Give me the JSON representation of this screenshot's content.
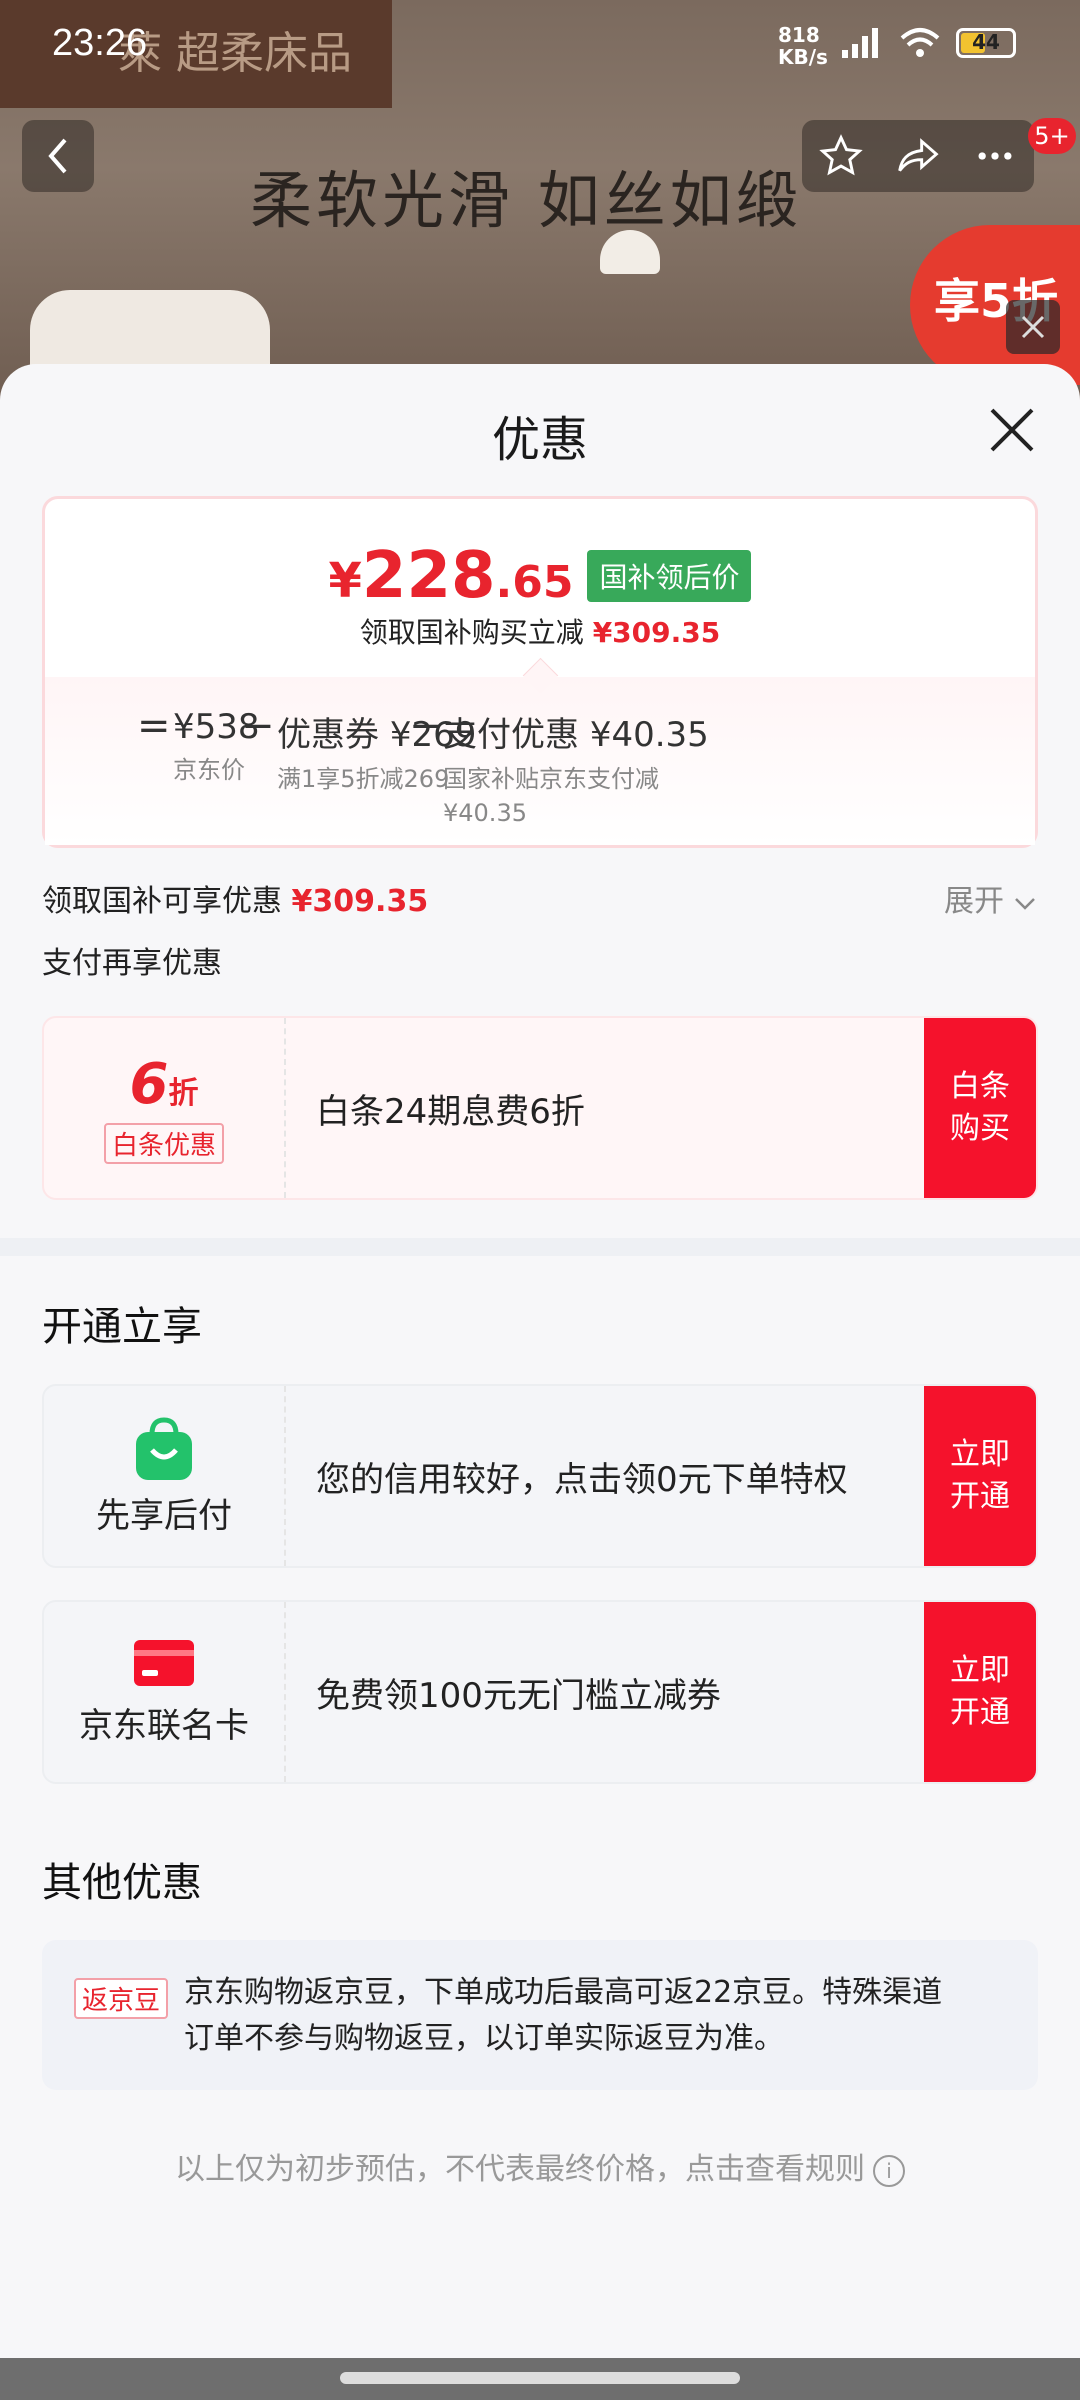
{
  "status_bar": {
    "time": "23:26",
    "speed_value": "818",
    "speed_unit": "KB/s",
    "battery": "44"
  },
  "background": {
    "brand": "萊 超柔床品",
    "slogan": "柔软光滑 如丝如缎",
    "badge": "5+",
    "promo": "享5折"
  },
  "sheet": {
    "title": "优惠",
    "price": {
      "currency": "¥",
      "integer": "228",
      "decimal": ".65",
      "tag": "国补领后价",
      "sub_label": "领取国补购买立减",
      "sub_amount": "¥309.35",
      "breakdown": {
        "equals": "=",
        "minus": "−",
        "jd_price": "¥538",
        "jd_price_label": "京东价",
        "coupon_label": "优惠券",
        "coupon": "¥269",
        "coupon_desc": "满1享5折减269",
        "pay_label": "支付优惠",
        "pay": "¥40.35",
        "pay_desc_1": "国家补贴京东支付减",
        "pay_desc_2": "¥40.35"
      }
    },
    "subsidy_row": {
      "label": "领取国补可享优惠",
      "amount": "¥309.35",
      "expand": "展开"
    },
    "pay_more_label": "支付再享优惠",
    "baitiao": {
      "discount_num": "6",
      "discount_unit": "折",
      "tag": "白条优惠",
      "desc": "白条24期息费6折",
      "cta_1": "白条",
      "cta_2": "购买"
    },
    "open_section_title": "开通立享",
    "open_offers": [
      {
        "name": "先享后付",
        "desc": "您的信用较好，点击领0元下单特权",
        "cta_1": "立即",
        "cta_2": "开通"
      },
      {
        "name": "京东联名卡",
        "desc": "免费领100元无门槛立减券",
        "cta_1": "立即",
        "cta_2": "开通"
      }
    ],
    "other_section_title": "其他优惠",
    "cashback": {
      "tag": "返京豆",
      "text": "京东购物返京豆，下单成功后最高可返22京豆。特殊渠道订单不参与购物返豆，以订单实际返豆为准。"
    },
    "footnote": "以上仅为初步预估，不代表最终价格，点击查看规则",
    "footnote_icon": "i"
  },
  "colors": {
    "accent": "#e8242e",
    "cta": "#f5122c",
    "tag_green": "#38a95a"
  }
}
